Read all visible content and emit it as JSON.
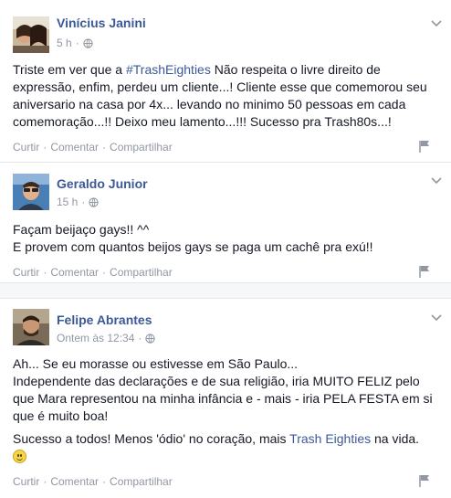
{
  "posts": [
    {
      "author": "Vinícius Janini",
      "time": "5 h",
      "paragraphs": [
        [
          "Triste em ver que a ",
          "#TrashEighties",
          " Não respeita o livre direito de expressão, enfim, perdeu um cliente...! Cliente esse que comemorou seu aniversario na casa por 4x... levando no minimo 50 pessoas em cada comemoração...!! Deixo meu lamento...!!! Sucesso pra Trash80s...!"
        ]
      ]
    },
    {
      "author": "Geraldo Junior",
      "time": "15 h",
      "lines": [
        "Façam beijaço gays!! ^^",
        "E provem com quantos beijos gays se paga um cachê pra exú!!"
      ]
    },
    {
      "author": "Felipe Abrantes",
      "time": "Ontem às 12:34",
      "paragraph1_line1": "Ah... Se eu morasse ou estivesse em São Paulo...",
      "paragraph1_line2": "Independente das declarações e de sua religião, iria MUITO FELIZ pelo que Mara representou na minha infância e - mais - iria PELA FESTA em si que é muito boa!",
      "paragraph2_pre": "Sucesso a todos! Menos 'ódio' no coração, mais ",
      "paragraph2_tag": "Trash Eighties",
      "paragraph2_post": " na vida."
    }
  ],
  "actions": {
    "like": "Curtir",
    "comment": "Comentar",
    "share": "Compartilhar",
    "separator": "·"
  },
  "icons": {
    "privacy": "globe-icon",
    "menu": "chevron-down-icon",
    "report": "flag-icon",
    "emoji": "smile-emoji"
  },
  "colors": {
    "link": "#3b5998",
    "meta": "#9197a3",
    "text": "#141823"
  }
}
